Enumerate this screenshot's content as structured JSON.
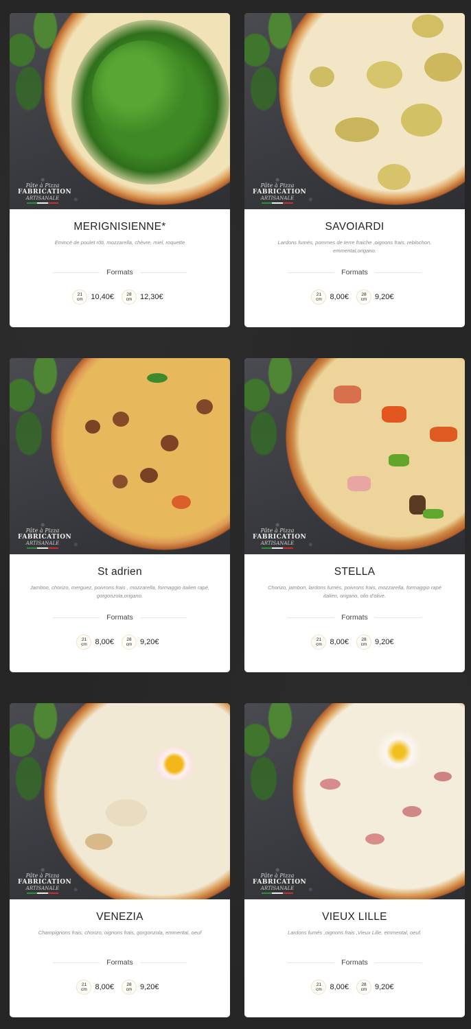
{
  "formats_label": "Formats",
  "unit": "cm",
  "badge": {
    "line1": "Pâte à Pizza",
    "line2": "FABRICATION",
    "line3": "ARTISANALE"
  },
  "colors": {
    "background": "#262626",
    "card": "#ffffff",
    "title": "#222222",
    "description": "#8a8a8a"
  },
  "pizzas": [
    {
      "name": "MERIGNISIENNE*",
      "description": "Emincé de poulet rôti, mozzarella, chèvre, miel, roquette",
      "sizes": [
        {
          "size": "21",
          "price": "10,40€"
        },
        {
          "size": "28",
          "price": "12,30€"
        }
      ]
    },
    {
      "name": "SAVOIARDI",
      "description": "Lardons fumés, pommes de terre fraiche ,oignons frais, reblochon, emmental,origano.",
      "sizes": [
        {
          "size": "21",
          "price": "8,00€"
        },
        {
          "size": "28",
          "price": "9,20€"
        }
      ]
    },
    {
      "name": "St adrien",
      "description": "Jambon, chorizo, merguez, poivrons frais , mozzarella, formaggio italien rapé, gorgonzola,origano.",
      "sizes": [
        {
          "size": "21",
          "price": "8,00€"
        },
        {
          "size": "28",
          "price": "9,20€"
        }
      ]
    },
    {
      "name": "STELLA",
      "description": "Chorizo, jambon, lardons fumés, poivrons frais, mozzarella, formaggio rapé italien, origano, olio d'olive.",
      "sizes": [
        {
          "size": "21",
          "price": "8,00€"
        },
        {
          "size": "28",
          "price": "9,20€"
        }
      ]
    },
    {
      "name": "VENEZIA",
      "description": "Champignons frais, chorizo, oignons frais, gorgonzola, emmental, oeuf",
      "sizes": [
        {
          "size": "21",
          "price": "8,00€"
        },
        {
          "size": "28",
          "price": "9,20€"
        }
      ]
    },
    {
      "name": "VIEUX LILLE",
      "description": "Lardons fumés ,oignons frais ,Vieux Lille, emmental, oeuf.",
      "sizes": [
        {
          "size": "21",
          "price": "8,00€"
        },
        {
          "size": "28",
          "price": "9,20€"
        }
      ]
    }
  ]
}
